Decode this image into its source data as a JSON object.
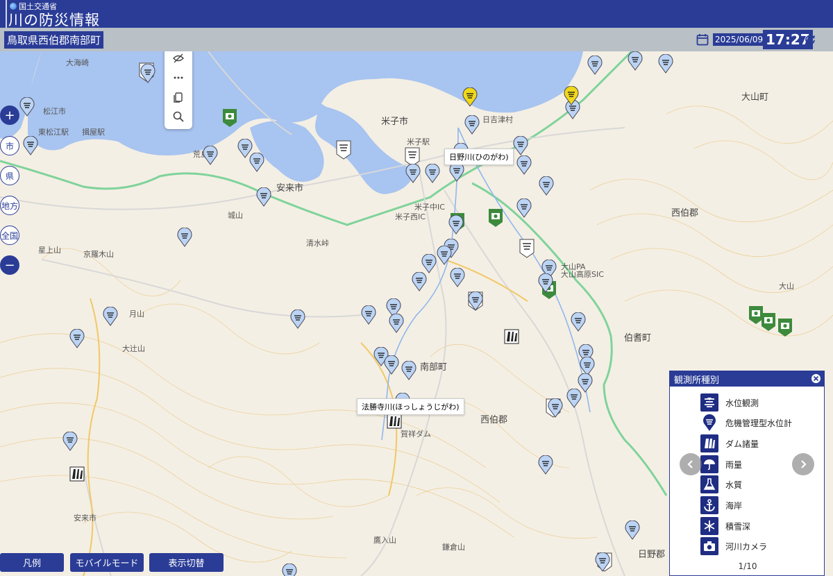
{
  "header": {
    "ministry": "国土交通省",
    "title": "川の防災情報"
  },
  "subbar": {
    "location": "鳥取県西伯郡南部町",
    "date": "2025/06/09",
    "time": "17:27"
  },
  "controls": {
    "zoom_in": "+",
    "city": "市",
    "prefecture": "県",
    "region": "地方",
    "national": "全国",
    "zoom_out": "−"
  },
  "map": {
    "places": [
      {
        "label": "大海崎",
        "key": "p1"
      },
      {
        "label": "松江市",
        "key": "p2"
      },
      {
        "label": "東松江駅",
        "key": "p3"
      },
      {
        "label": "揖屋駅",
        "key": "p4"
      },
      {
        "label": "荒島駅",
        "key": "p5"
      },
      {
        "label": "安来市",
        "key": "p6"
      },
      {
        "label": "米子市",
        "key": "p7"
      },
      {
        "label": "米子駅",
        "key": "p8"
      },
      {
        "label": "日吉津村",
        "key": "p9"
      },
      {
        "label": "米子西IC",
        "key": "p10"
      },
      {
        "label": "米子中IC",
        "key": "p11"
      },
      {
        "label": "西伯郡",
        "key": "p12"
      },
      {
        "label": "大山町",
        "key": "p13"
      },
      {
        "label": "伯耆町",
        "key": "p14"
      },
      {
        "label": "南部町",
        "key": "p15"
      },
      {
        "label": "西伯郡",
        "key": "p16"
      },
      {
        "label": "日野郡",
        "key": "p17"
      },
      {
        "label": "安来市",
        "key": "p18"
      },
      {
        "label": "大山",
        "key": "p19"
      },
      {
        "label": "大山PA",
        "key": "p20"
      },
      {
        "label": "大山高原SIC",
        "key": "p21"
      },
      {
        "label": "月山",
        "key": "p22"
      },
      {
        "label": "大辻山",
        "key": "p23"
      },
      {
        "label": "城山",
        "key": "p24"
      },
      {
        "label": "清水峠",
        "key": "p25"
      },
      {
        "label": "京羅木山",
        "key": "p26"
      },
      {
        "label": "星上山",
        "key": "p27"
      },
      {
        "label": "鷹入山",
        "key": "p28"
      },
      {
        "label": "鎌倉山",
        "key": "p29"
      },
      {
        "label": "賀祥ダム",
        "key": "p30"
      }
    ],
    "tips": {
      "hino": "日野川(ひのがわ)",
      "hosshoji": "法勝寺川(ほっしょうじがわ)"
    }
  },
  "bottom_buttons": {
    "legend": "凡例",
    "mobile": "モバイルモード",
    "switch": "表示切替"
  },
  "legend": {
    "title": "観測所種別",
    "items": [
      {
        "label": "水位観測",
        "icon": "water-level-icon"
      },
      {
        "label": "危機管理型水位計",
        "icon": "crisis-water-gauge-icon"
      },
      {
        "label": "ダム諸量",
        "icon": "dam-icon"
      },
      {
        "label": "雨量",
        "icon": "umbrella-icon"
      },
      {
        "label": "水質",
        "icon": "flask-icon"
      },
      {
        "label": "海岸",
        "icon": "anchor-icon"
      },
      {
        "label": "積雪深",
        "icon": "snowflake-icon"
      },
      {
        "label": "河川カメラ",
        "icon": "camera-icon"
      }
    ],
    "pager": "1/10"
  },
  "colors": {
    "brand": "#2a3c96",
    "sea": "#a8c4f0",
    "marker_blue": "#bcd4f4",
    "marker_yellow": "#f0d81a",
    "camera_green": "#3d8a3d",
    "expressway": "#7fd39a"
  }
}
